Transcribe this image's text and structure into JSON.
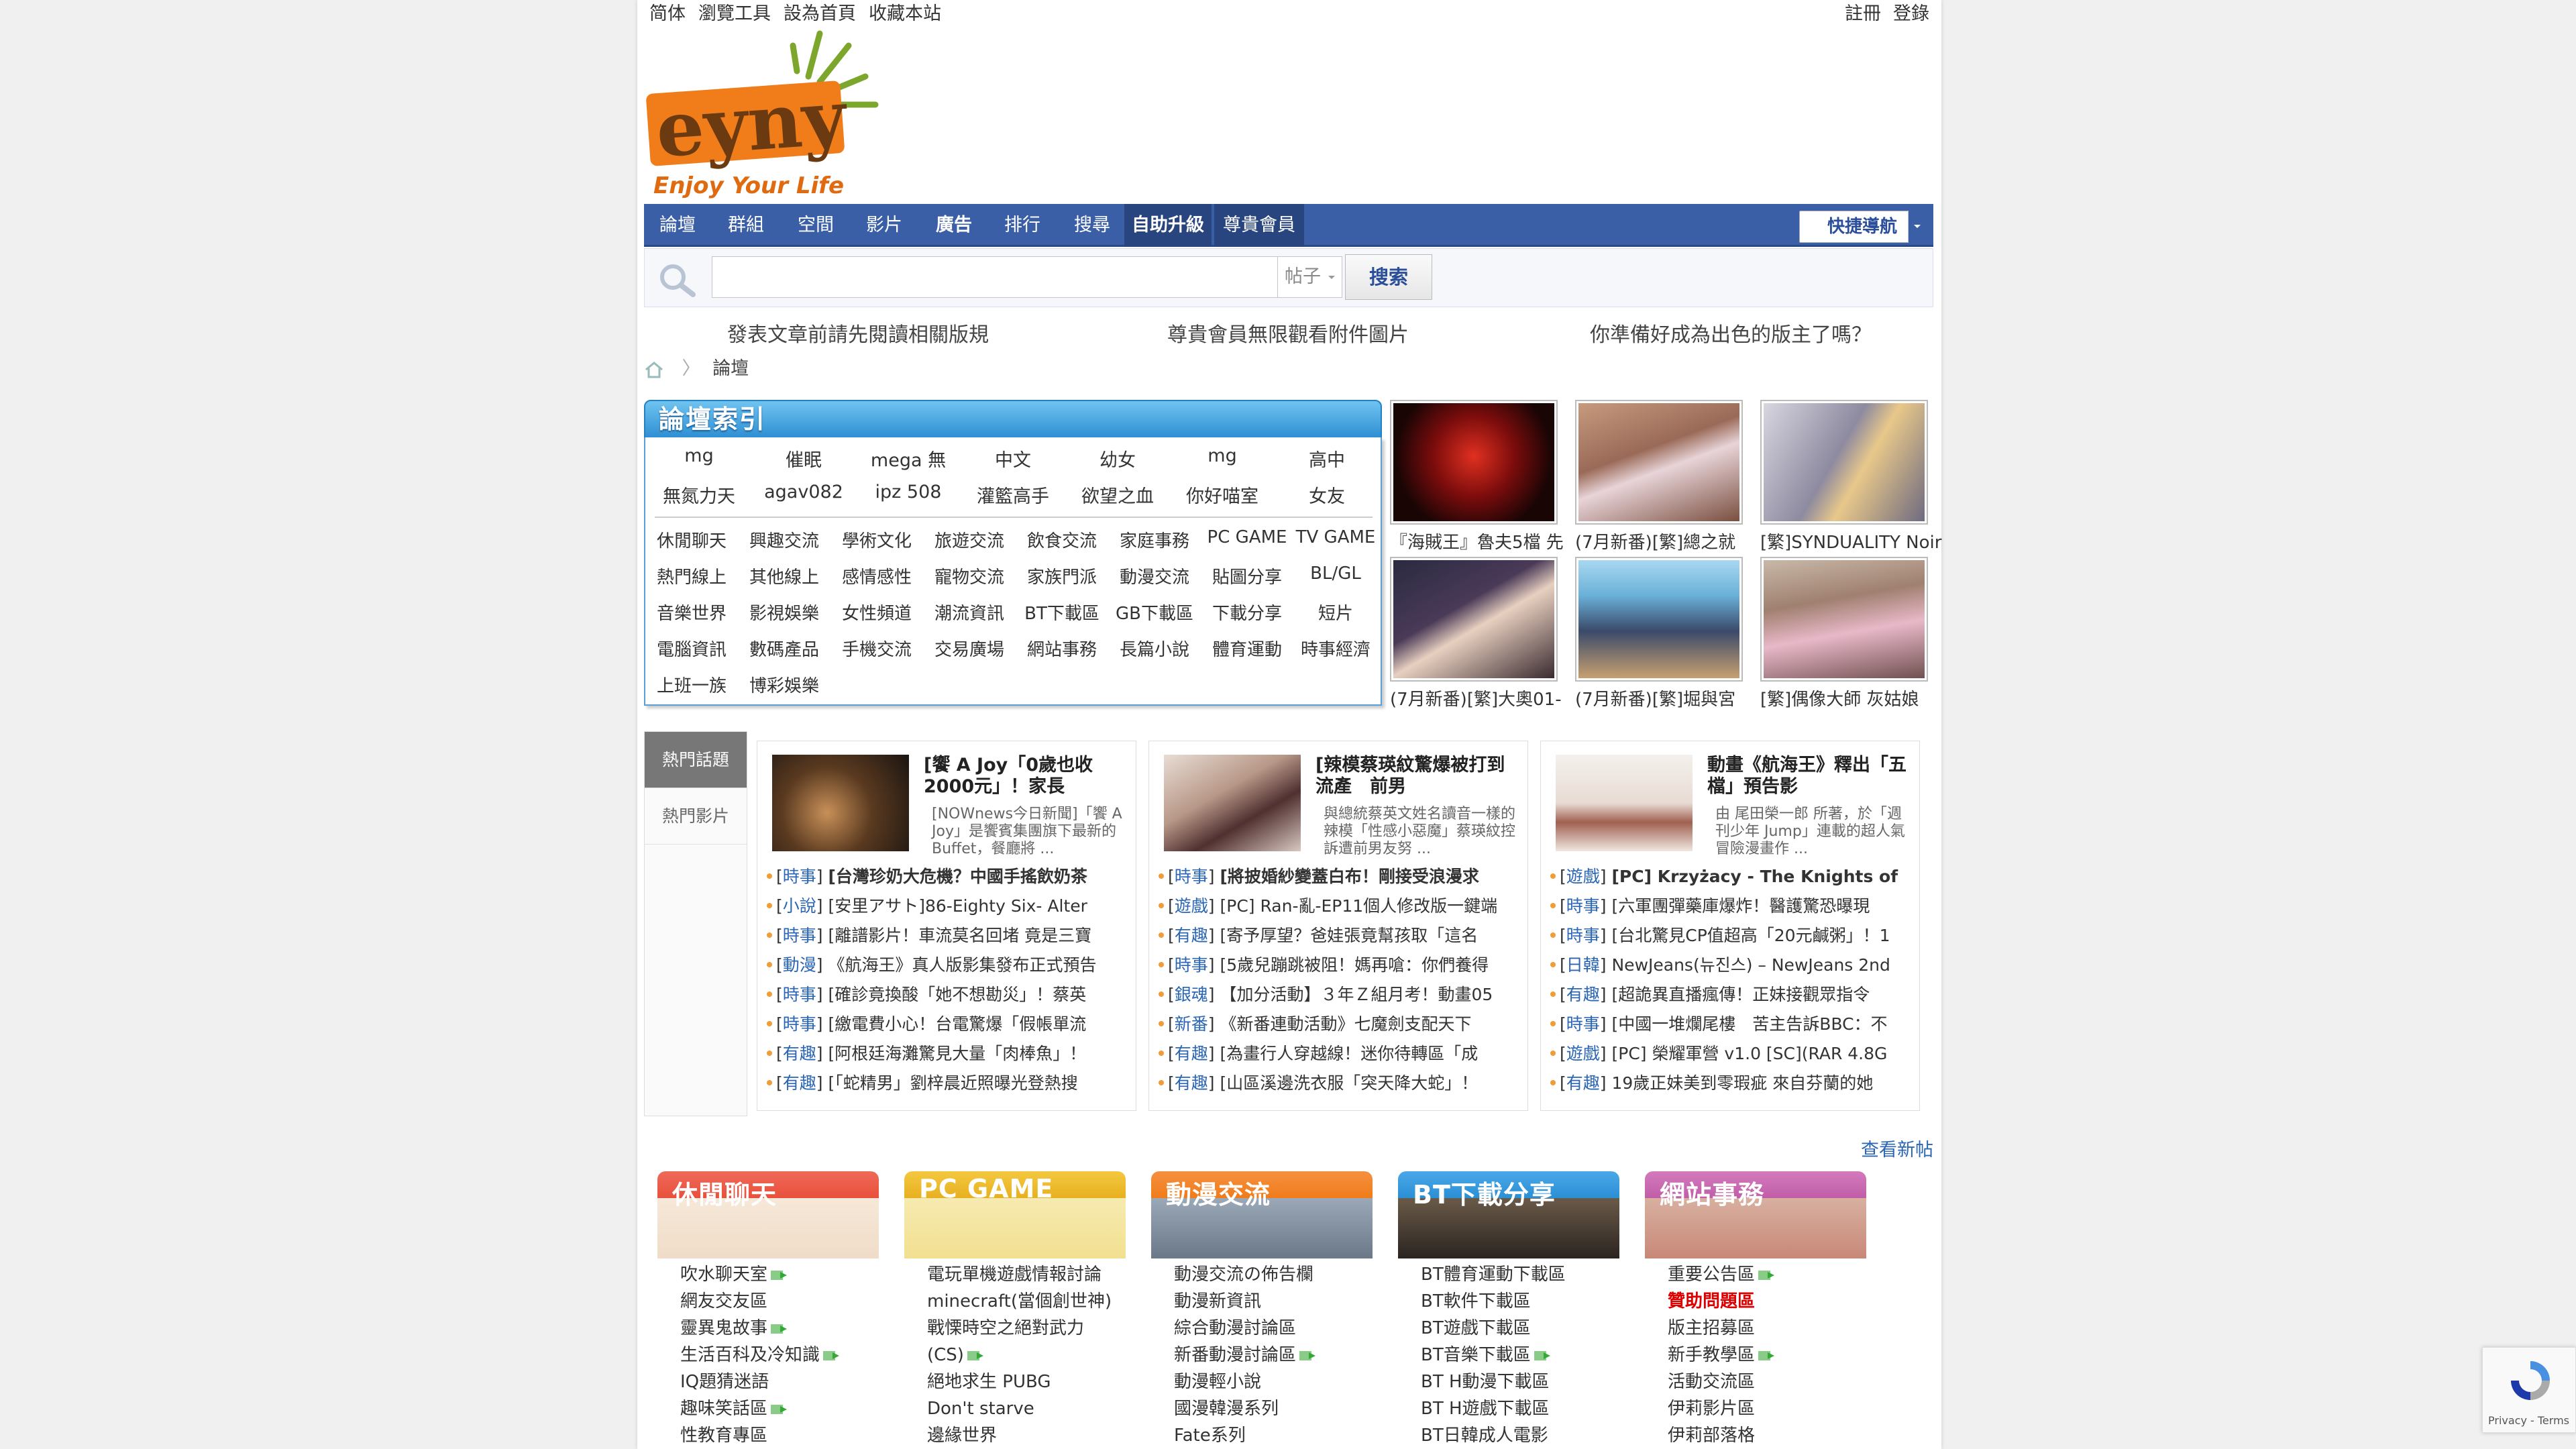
{
  "topbar": {
    "left_links": [
      "简体",
      "瀏覽工具",
      "設為首頁",
      "收藏本站"
    ],
    "right_links": [
      "註冊",
      "登錄"
    ]
  },
  "logo": {
    "text": "eyny",
    "slogan": "Enjoy Your Life",
    "colors": {
      "orange": "#f07c1a",
      "green": "#7ca62c"
    }
  },
  "nav": {
    "items": [
      "論壇",
      "群組",
      "空間",
      "影片",
      "廣告",
      "排行",
      "搜尋",
      "自助升級",
      "尊貴會員"
    ],
    "quick_label": "快捷導航",
    "color": "#3a5fa6"
  },
  "search": {
    "placeholder": "",
    "type": "帖子",
    "button": "搜索"
  },
  "notices": [
    "發表文章前請先閱讀相關版規",
    "尊貴會員無限觀看附件圖片",
    "你準備好成為出色的版主了嗎？"
  ],
  "breadcrumb": {
    "current": "論壇"
  },
  "forum_index": {
    "title": "論壇索引",
    "keywords_row1": [
      "mg",
      "催眠",
      "mega 無",
      "中文",
      "幼女",
      "mg",
      "高中"
    ],
    "keywords_row2": [
      "無氮力天",
      "agav082",
      "ipz 508",
      "灌籃高手",
      "欲望之血",
      "你好喵室",
      "女友"
    ],
    "categories": [
      [
        "休閒聊天",
        "興趣交流",
        "學術文化",
        "旅遊交流",
        "飲食交流",
        "家庭事務",
        "PC GAME",
        "TV GAME"
      ],
      [
        "熱門線上",
        "其他線上",
        "感情感性",
        "寵物交流",
        "家族門派",
        "動漫交流",
        "貼圖分享",
        "BL/GL"
      ],
      [
        "音樂世界",
        "影視娛樂",
        "女性頻道",
        "潮流資訊",
        "BT下載區",
        "GB下載區",
        "下載分享",
        "短片"
      ],
      [
        "電腦資訊",
        "數碼產品",
        "手機交流",
        "交易廣場",
        "網站事務",
        "長篇小說",
        "體育運動",
        "時事經濟"
      ],
      [
        "上班一族",
        "博彩娛樂"
      ]
    ]
  },
  "thumbnails": [
    {
      "caption": "『海賊王』魯夫5檔 先"
    },
    {
      "caption": "(7月新番)[繁]總之就"
    },
    {
      "caption": "[繁]SYNDUALITY Noir"
    },
    {
      "caption": "(7月新番)[繁]大奧01-"
    },
    {
      "caption": "(7月新番)[繁]堀與宮"
    },
    {
      "caption": "[繁]偶像大師 灰姑娘"
    }
  ],
  "hot": {
    "tabs": [
      "熱門話題",
      "熱門影片"
    ],
    "columns": [
      {
        "headline": "[饗 A Joy「0歲也收2000元」！家長",
        "desc": "[NOWnews今日新聞]「饗 A Joy」是饗賓集團旗下最新的Buffet，餐廳將 ...",
        "items": [
          {
            "tag": "時事",
            "text": "[台灣珍奶大危機？中國手搖飲奶茶",
            "bold": true
          },
          {
            "tag": "小說",
            "text": "[安里アサト]86-Eighty Six- Alter"
          },
          {
            "tag": "時事",
            "text": "[離譜影片！車流莫名回堵 竟是三寶"
          },
          {
            "tag": "動漫",
            "text": "《航海王》真人版影集發布正式預告"
          },
          {
            "tag": "時事",
            "text": "[確診竟換酸「她不想勘災」！蔡英"
          },
          {
            "tag": "時事",
            "text": "[繳電費小心！台電驚爆「假帳單流"
          },
          {
            "tag": "有趣",
            "text": "[阿根廷海灘驚見大量「肉棒魚」！"
          },
          {
            "tag": "有趣",
            "text": "[「蛇精男」劉梓晨近照曝光登熱搜"
          }
        ]
      },
      {
        "headline": "[辣模蔡瑛紋驚爆被打到流產　前男",
        "desc": "與總統蔡英文姓名讀音一樣的辣模「性感小惡魔」蔡瑛紋控訴遭前男友努 ...",
        "items": [
          {
            "tag": "時事",
            "text": "[將披婚紗變蓋白布！剛接受浪漫求",
            "bold": true
          },
          {
            "tag": "遊戲",
            "text": "[PC] Ran-亂-EP11個人修改版一鍵端"
          },
          {
            "tag": "有趣",
            "text": "[寄予厚望？爸娃張竟幫孩取「這名"
          },
          {
            "tag": "時事",
            "text": "[5歲兒蹦跳被阻！媽再嗆：你們養得"
          },
          {
            "tag": "銀魂",
            "text": "【加分活動】３年Ｚ組月考！動畫05"
          },
          {
            "tag": "新番",
            "text": "《新番連動活動》七魔劍支配天下"
          },
          {
            "tag": "有趣",
            "text": "[為畫行人穿越線！迷你待轉區「成"
          },
          {
            "tag": "有趣",
            "text": "[山區溪邊洗衣服「突天降大蛇」！"
          }
        ]
      },
      {
        "headline": "動畫《航海王》釋出「五檔」預告影",
        "desc": "由 尾田榮一郎 所著，於「週刊少年 Jump」連載的超人氣冒險漫畫作 ...",
        "items": [
          {
            "tag": "遊戲",
            "text": "[PC] Krzyżacy - The Knights of",
            "bold": true
          },
          {
            "tag": "時事",
            "text": "[六軍團彈藥庫爆炸！醫護驚恐曝現"
          },
          {
            "tag": "時事",
            "text": "[台北驚見CP值超高「20元鹹粥」！1"
          },
          {
            "tag": "日韓",
            "text": "NewJeans(뉴진스) – NewJeans 2nd"
          },
          {
            "tag": "有趣",
            "text": "[超詭異直播瘋傳！正妹接觀眾指令"
          },
          {
            "tag": "時事",
            "text": "[中國一堆爛尾樓　苦主告訴BBC：不"
          },
          {
            "tag": "遊戲",
            "text": "[PC] 榮耀軍營 v1.0 [SC](RAR 4.8G"
          },
          {
            "tag": "有趣",
            "text": "19歲正妹美到零瑕疵 來自芬蘭的她"
          }
        ]
      }
    ]
  },
  "more_link": "查看新帖",
  "bottom_categories": [
    {
      "title": "休閒聊天",
      "color": "#e9503b",
      "items": [
        {
          "label": "吹水聊天室",
          "new": true
        },
        {
          "label": "網友交友區"
        },
        {
          "label": "靈異鬼故事",
          "new": true
        },
        {
          "label": "生活百科及冷知識",
          "new": true
        },
        {
          "label": "IQ題猜迷語"
        },
        {
          "label": "趣味笑話區",
          "new": true
        },
        {
          "label": "性教育專區"
        }
      ]
    },
    {
      "title": "PC GAME",
      "color": "#e8b020",
      "items": [
        {
          "label": "電玩單機遊戲情報討論"
        },
        {
          "label": "minecraft(當個創世神)"
        },
        {
          "label": "戰慄時空之絕對武力"
        },
        {
          "label": "(CS)",
          "new": true
        },
        {
          "label": "絕地求生 PUBG"
        },
        {
          "label": "Don't starve"
        },
        {
          "label": "邊緣世界"
        }
      ]
    },
    {
      "title": "動漫交流",
      "color": "#f07c1a",
      "items": [
        {
          "label": "動漫交流の佈告欄"
        },
        {
          "label": "動漫新資訊"
        },
        {
          "label": "綜合動漫討論區"
        },
        {
          "label": "新番動漫討論區",
          "new": true
        },
        {
          "label": "動漫輕小說"
        },
        {
          "label": "國漫韓漫系列"
        },
        {
          "label": "Fate系列"
        }
      ]
    },
    {
      "title": "BT下載分享",
      "color": "#2b8fd4",
      "items": [
        {
          "label": "BT體育運動下載區"
        },
        {
          "label": "BT軟件下載區"
        },
        {
          "label": "BT遊戲下載區"
        },
        {
          "label": "BT音樂下載區",
          "new": true
        },
        {
          "label": "BT H動漫下載區"
        },
        {
          "label": "BT H遊戲下載區"
        },
        {
          "label": "BT日韓成人電影"
        }
      ]
    },
    {
      "title": "網站事務",
      "color": "#c05ea8",
      "items": [
        {
          "label": "重要公告區",
          "new": true
        },
        {
          "label": "贊助問題區",
          "red": true
        },
        {
          "label": "版主招募區"
        },
        {
          "label": "新手教學區",
          "new": true
        },
        {
          "label": "活動交流區"
        },
        {
          "label": "伊莉影片區"
        },
        {
          "label": "伊莉部落格"
        }
      ]
    }
  ],
  "recaptcha": {
    "links": "Privacy - Terms"
  }
}
